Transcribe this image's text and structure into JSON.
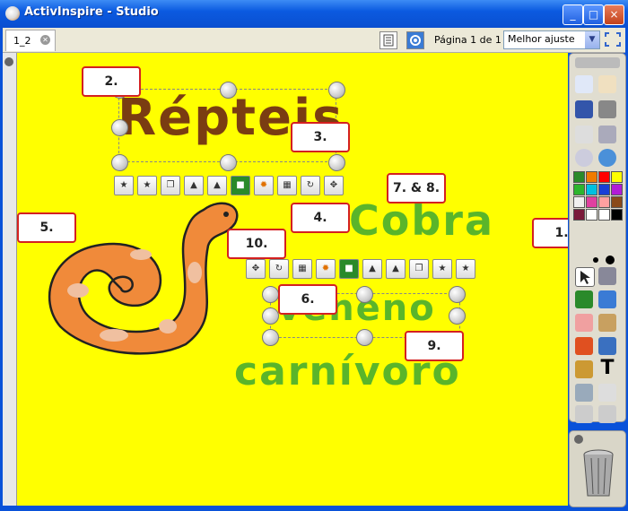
{
  "window": {
    "title": "ActivInspire - Studio",
    "min": "_",
    "max": "□",
    "close": "×"
  },
  "tabs": [
    {
      "label": "1_2"
    }
  ],
  "toolbar": {
    "page_label": "Página 1 de 1",
    "zoom_value": "Melhor ajuste"
  },
  "canvas": {
    "words": {
      "title": "Répteis",
      "cobra": "Cobra",
      "veneno": "veneno",
      "carnivoro": "carnívoro"
    },
    "callouts": {
      "c1": "1.",
      "c2": "2.",
      "c3": "3.",
      "c4": "4.",
      "c5": "5.",
      "c6": "6.",
      "c78": "7. & 8.",
      "c9": "9.",
      "c10": "10."
    }
  },
  "toolbox": {
    "text_tool_label": "T",
    "colors": [
      "#2a8a2a",
      "#f07b00",
      "#ff0000",
      "#ffff00",
      "#2db52d",
      "#00c0e0",
      "#1a3fd6",
      "#b21cd6",
      "#f0f0f0",
      "#e040a0",
      "#ffa0a0",
      "#8a4a1a",
      "#7a1a3a",
      "#ffffff",
      "#ffffff",
      "#000000"
    ]
  },
  "colors": {
    "canvas_bg": "#ffff00",
    "accent_border": "#d42020",
    "title_text": "#7a3d12",
    "green_text": "#5ab52a"
  }
}
